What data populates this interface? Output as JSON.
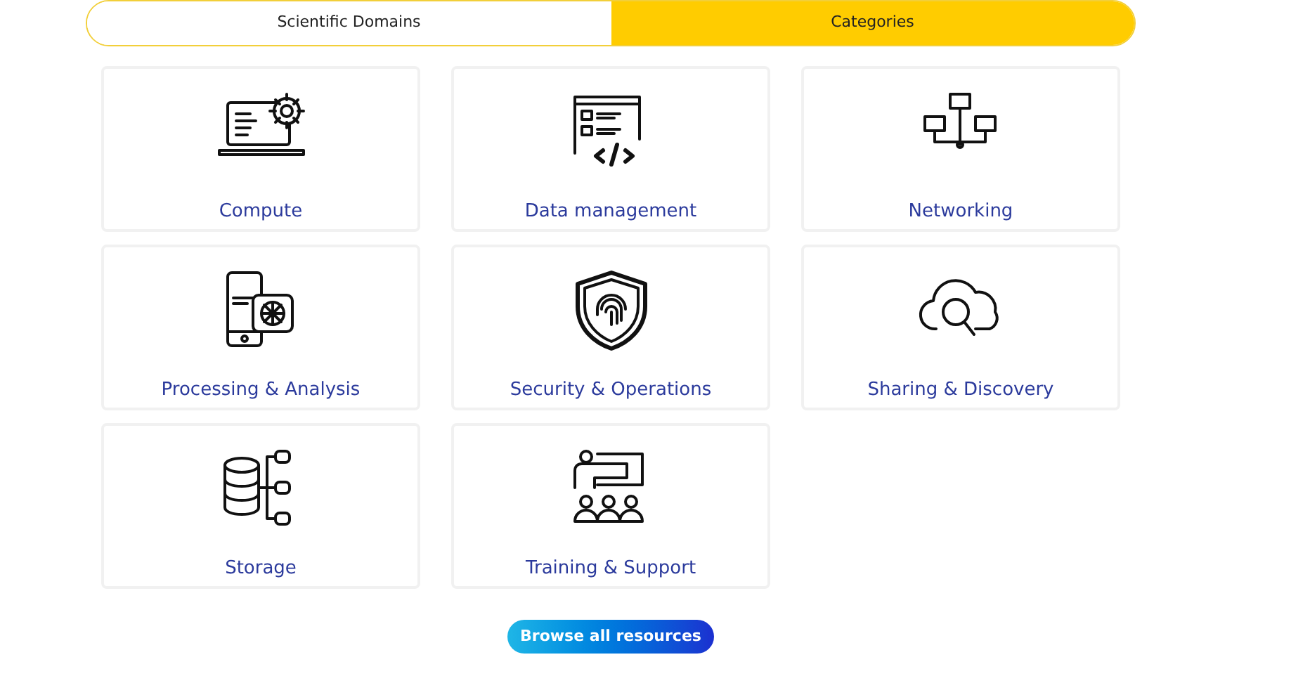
{
  "tabs": [
    {
      "label": "Scientific Domains",
      "selected": false
    },
    {
      "label": "Categories",
      "selected": true
    }
  ],
  "categories": [
    {
      "kind": "compute",
      "label": "Compute"
    },
    {
      "kind": "data",
      "label": "Data management"
    },
    {
      "kind": "network",
      "label": "Networking"
    },
    {
      "kind": "processing",
      "label": "Processing & Analysis"
    },
    {
      "kind": "security",
      "label": "Security & Operations"
    },
    {
      "kind": "sharing",
      "label": "Sharing & Discovery"
    },
    {
      "kind": "storage",
      "label": "Storage"
    },
    {
      "kind": "training",
      "label": "Training & Support"
    }
  ],
  "browse_button": "Browse all resources"
}
